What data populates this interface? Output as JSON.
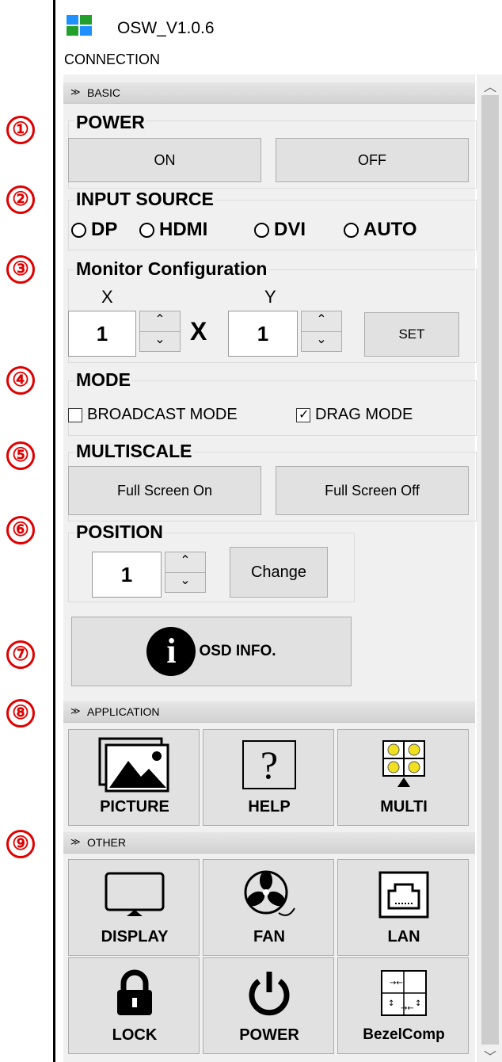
{
  "app": {
    "title": "OSW_V1.0.6",
    "menu": "CONNECTION",
    "icon_colors": [
      "#1e90ff",
      "#22a02c",
      "#22a02c",
      "#1e90ff"
    ]
  },
  "annotations": [
    "①",
    "②",
    "③",
    "④",
    "⑤",
    "⑥",
    "⑦",
    "⑧",
    "⑨"
  ],
  "sections": {
    "basic": "BASIC",
    "application": "APPLICATION",
    "other": "OTHER"
  },
  "power": {
    "label": "POWER",
    "on": "ON",
    "off": "OFF"
  },
  "input_source": {
    "label": "INPUT SOURCE",
    "options": [
      "DP",
      "HDMI",
      "DVI",
      "AUTO"
    ]
  },
  "monitor_config": {
    "label": "Monitor Configuration",
    "x_label": "X",
    "y_label": "Y",
    "x_value": "1",
    "y_value": "1",
    "separator": "X",
    "set": "SET"
  },
  "mode": {
    "label": "MODE",
    "broadcast": "BROADCAST MODE",
    "broadcast_checked": false,
    "drag": "DRAG MODE",
    "drag_checked": true
  },
  "multiscale": {
    "label": "MULTISCALE",
    "on": "Full Screen On",
    "off": "Full Screen Off"
  },
  "position": {
    "label": "POSITION",
    "value": "1",
    "change": "Change"
  },
  "osd": {
    "label": "OSD INFO.",
    "icon_glyph": "i"
  },
  "application_tiles": [
    {
      "label": "PICTURE",
      "icon": "picture-icon"
    },
    {
      "label": "HELP",
      "icon": "help-icon",
      "glyph": "?"
    },
    {
      "label": "MULTI",
      "icon": "multi-icon"
    }
  ],
  "other_tiles": [
    {
      "label": "DISPLAY",
      "icon": "display-icon"
    },
    {
      "label": "FAN",
      "icon": "fan-icon"
    },
    {
      "label": "LAN",
      "icon": "lan-icon"
    },
    {
      "label": "LOCK",
      "icon": "lock-icon"
    },
    {
      "label": "POWER",
      "icon": "power-icon"
    },
    {
      "label": "BezelComp",
      "icon": "bezel-icon"
    }
  ]
}
